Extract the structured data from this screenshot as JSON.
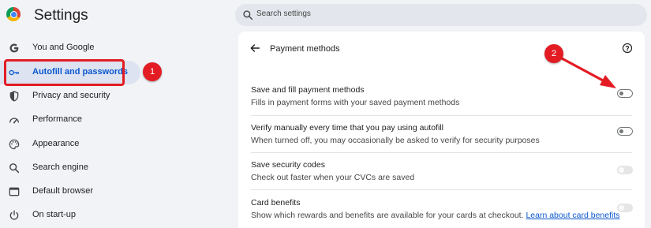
{
  "header": {
    "title": "Settings",
    "search_placeholder": "Search settings"
  },
  "sidebar": {
    "items": [
      {
        "label": "You and Google",
        "icon": "google-g-icon"
      },
      {
        "label": "Autofill and passwords",
        "icon": "key-icon",
        "active": true
      },
      {
        "label": "Privacy and security",
        "icon": "shield-icon"
      },
      {
        "label": "Performance",
        "icon": "speedometer-icon"
      },
      {
        "label": "Appearance",
        "icon": "palette-icon"
      },
      {
        "label": "Search engine",
        "icon": "search-icon"
      },
      {
        "label": "Default browser",
        "icon": "browser-window-icon"
      },
      {
        "label": "On start-up",
        "icon": "power-icon"
      }
    ]
  },
  "page": {
    "title": "Payment methods",
    "rows": [
      {
        "title": "Save and fill payment methods",
        "desc": "Fills in payment forms with your saved payment methods",
        "toggle": "off"
      },
      {
        "title": "Verify manually every time that you pay using autofill",
        "desc": "When turned off, you may occasionally be asked to verify for security purposes",
        "toggle": "off"
      },
      {
        "title": "Save security codes",
        "desc": "Check out faster when your CVCs are saved",
        "toggle": "disabled"
      },
      {
        "title": "Card benefits",
        "desc": "Show which rewards and benefits are available for your cards at checkout.",
        "link": "Learn about card benefits",
        "toggle": "disabled"
      }
    ]
  },
  "annotations": {
    "step1": "1",
    "step2": "2",
    "color": "#e31c24"
  },
  "colors": {
    "accent": "#0b57d0",
    "background": "#f1f3f7",
    "active_nav_bg": "#dde3f0"
  }
}
